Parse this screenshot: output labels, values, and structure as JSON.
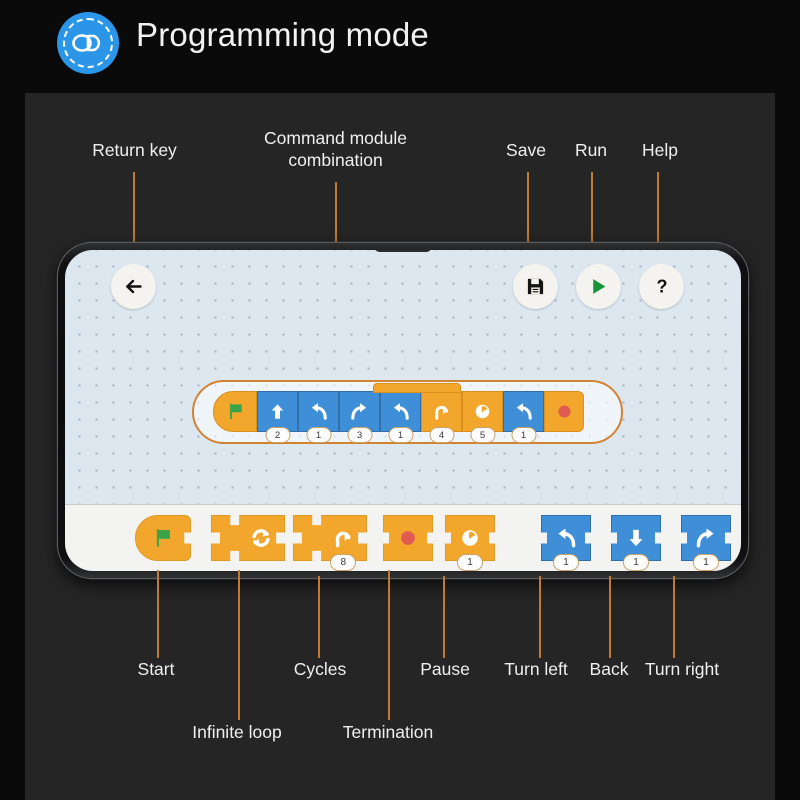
{
  "header": {
    "title": "Programming mode",
    "icon": "programming-mode-badge-icon"
  },
  "annotations": {
    "return_key": "Return key",
    "command_module": "Command module\ncombination",
    "save": "Save",
    "run": "Run",
    "help": "Help",
    "start": "Start",
    "infinite_loop": "Infinite loop",
    "cycles": "Cycles",
    "termination": "Termination",
    "pause": "Pause",
    "turn_left": "Turn left",
    "back": "Back",
    "turn_right": "Turn right"
  },
  "toolbar": {
    "back_icon": "arrow-left-icon",
    "save_icon": "floppy-disk-icon",
    "run_icon": "play-triangle-icon",
    "help_icon": "question-mark-icon"
  },
  "program": {
    "blocks": [
      {
        "icon": "green-flag-icon",
        "kind": "start",
        "color": "orange",
        "badge": ""
      },
      {
        "icon": "arrow-up-icon",
        "kind": "forward",
        "color": "blue",
        "badge": "2"
      },
      {
        "icon": "turn-left-icon",
        "kind": "turn-left",
        "color": "blue",
        "badge": "1"
      },
      {
        "icon": "turn-right-icon",
        "kind": "turn-right",
        "color": "blue",
        "badge": "3"
      },
      {
        "icon": "turn-left-icon",
        "kind": "turn-left",
        "color": "blue",
        "badge": "1"
      },
      {
        "icon": "loop-icon",
        "kind": "cycles",
        "color": "orange",
        "badge": "4"
      },
      {
        "icon": "clock-icon",
        "kind": "pause",
        "color": "orange",
        "badge": "5"
      },
      {
        "icon": "turn-left-icon",
        "kind": "turn-left",
        "color": "blue",
        "badge": "1"
      },
      {
        "icon": "red-dot-icon",
        "kind": "termination",
        "color": "orange",
        "badge": ""
      }
    ]
  },
  "palette": {
    "blocks": [
      {
        "icon": "green-flag-icon",
        "kind": "start",
        "color": "orange",
        "badge": ""
      },
      {
        "icon": "infinite-loop-icon",
        "kind": "infinite-loop",
        "color": "orange",
        "badge": ""
      },
      {
        "icon": "loop-icon",
        "kind": "cycles",
        "color": "orange",
        "badge": "8"
      },
      {
        "icon": "red-dot-icon",
        "kind": "termination",
        "color": "orange",
        "badge": ""
      },
      {
        "icon": "clock-icon",
        "kind": "pause",
        "color": "orange",
        "badge": "1"
      },
      {
        "icon": "turn-left-icon",
        "kind": "turn-left",
        "color": "blue",
        "badge": "1"
      },
      {
        "icon": "arrow-down-icon",
        "kind": "back",
        "color": "blue",
        "badge": "1"
      },
      {
        "icon": "turn-right-icon",
        "kind": "turn-right",
        "color": "blue",
        "badge": "1"
      }
    ]
  },
  "colors": {
    "brand_blue": "#2b96e8",
    "block_orange": "#f2a72c",
    "block_blue": "#3f8fd8",
    "flag_green": "#3aa34a",
    "stop_red": "#e25b52",
    "leader_line": "#c07a32",
    "panel_bg": "#252525",
    "page_bg": "#0a0a0a",
    "canvas_bg": "#dce7f0"
  }
}
